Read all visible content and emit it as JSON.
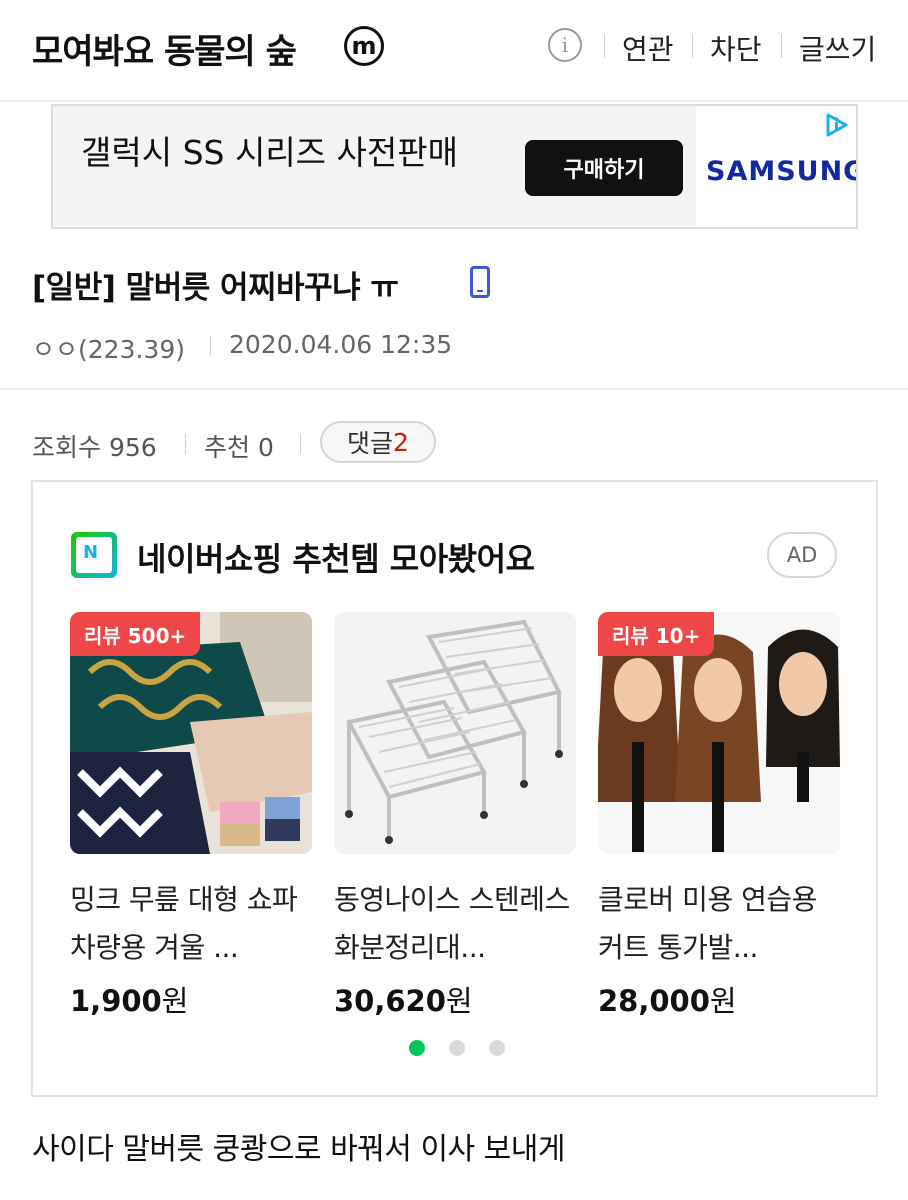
{
  "header": {
    "gallery_title": "모여봐요 동물의 숲",
    "m_badge": "m",
    "info_icon": "info-icon",
    "links": [
      "연관",
      "차단",
      "글쓰기"
    ]
  },
  "ad_banner": {
    "text": "갤럭시 SS 시리즈 사전판매",
    "button": "구매하기",
    "brand": "SAMSUNG",
    "icon": "adchoices-icon"
  },
  "post": {
    "title": "[일반] 말버릇 어찌바꾸냐 ㅠ",
    "device_icon": "mobile-icon",
    "author": "ㅇㅇ(223.39)",
    "date": "2020.04.06 12:35",
    "views_label": "조회수 956",
    "recommend_label": "추천 0",
    "comment_label": "댓글",
    "comment_count": "2",
    "body": "사이다 말버릇 쿵쾅으로 바꿔서 이사 보내게"
  },
  "shopping": {
    "title": "네이버쇼핑 추천템 모아봤어요",
    "ad_badge": "AD",
    "products": [
      {
        "badge": "리뷰 500+",
        "name": "밍크 무릎 대형 쇼파 차량용 겨울 ...",
        "price": "1,900",
        "unit": "원"
      },
      {
        "badge": "",
        "name": "동영나이스 스텐레스 화분정리대...",
        "price": "30,620",
        "unit": "원"
      },
      {
        "badge": "리뷰 10+",
        "name": "클로버 미용 연습용 커트 통가발...",
        "price": "28,000",
        "unit": "원"
      }
    ],
    "active_page": 1,
    "page_count": 3
  },
  "colors": {
    "accent_red": "#d31900",
    "badge_red": "#ef4747",
    "dot_active": "#03c75a",
    "samsung_blue": "#1428a0"
  }
}
